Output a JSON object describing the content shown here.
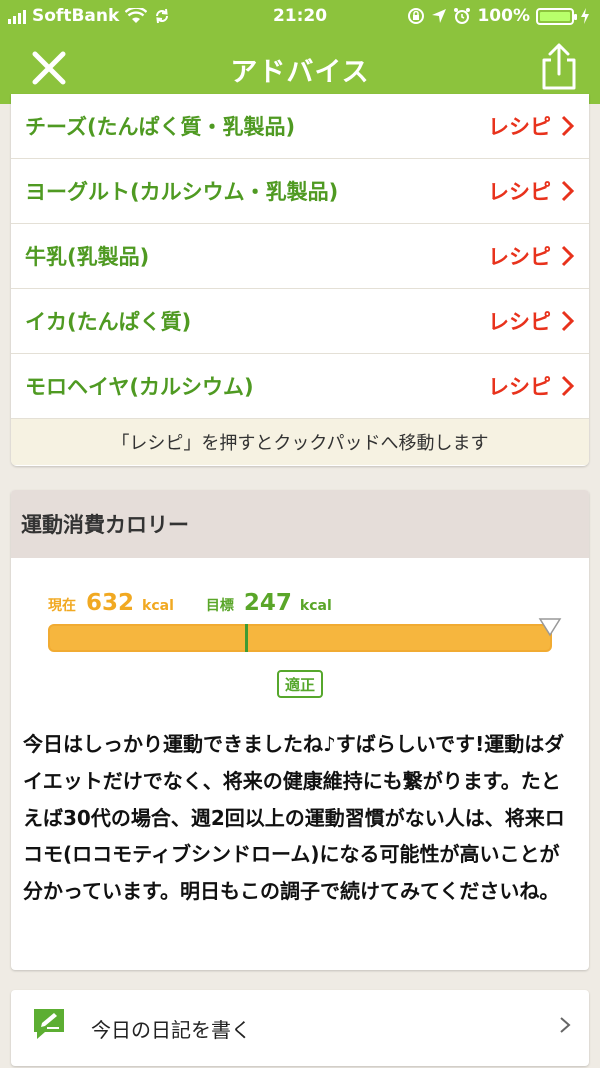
{
  "status_bar": {
    "carrier": "SoftBank",
    "time": "21:20",
    "battery_percent": "100%",
    "battery_level": 1.0
  },
  "nav": {
    "title": "アドバイス",
    "close_icon": "close-icon",
    "share_icon": "share-icon"
  },
  "recipes": {
    "items": [
      {
        "food": "チーズ(たんぱく質・乳製品)",
        "link": "レシピ"
      },
      {
        "food": "ヨーグルト(カルシウム・乳製品)",
        "link": "レシピ"
      },
      {
        "food": "牛乳(乳製品)",
        "link": "レシピ"
      },
      {
        "food": "イカ(たんぱく質)",
        "link": "レシピ"
      },
      {
        "food": "モロヘイヤ(カルシウム)",
        "link": "レシピ"
      }
    ],
    "note": "「レシピ」を押すとクックパッドへ移動します"
  },
  "calorie": {
    "header": "運動消費カロリー",
    "current_label": "現在",
    "current_value": "632",
    "current_unit": "kcal",
    "target_label": "目標",
    "target_value": "247",
    "target_unit": "kcal",
    "status": "適正",
    "advice": "今日はしっかり運動できましたね♪すばらしいです!運動はダイエットだけでなく、将来の健康維持にも繋がります。たとえば30代の場合、週2回以上の運動習慣がない人は、将来ロコモ(ロコモティブシンドローム)になる可能性が高いことが分かっています。明日もこの調子で続けてみてくださいね。",
    "colors": {
      "current": "#f1a922",
      "target": "#5aa629",
      "gauge": "#f6b63e"
    }
  },
  "diary": {
    "label": "今日の日記を書く",
    "icon": "pencil-note-icon"
  },
  "colors": {
    "header": "#8cc33d",
    "food_text": "#4f9a22",
    "recipe_link": "#e8321c"
  }
}
